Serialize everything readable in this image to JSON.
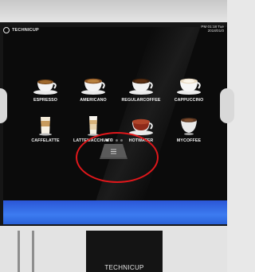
{
  "screen": {
    "brand": "TECHNICUP",
    "time": "PM 01:18 Tue",
    "date": "2018/01/0"
  },
  "drinks": [
    {
      "label": "ESPRESSO",
      "icon": "espresso-cup-icon"
    },
    {
      "label": "AMERICANO",
      "icon": "americano-cup-icon"
    },
    {
      "label": "REGULARCOFFEE",
      "icon": "regular-coffee-cup-icon"
    },
    {
      "label": "CAPPUCCINO",
      "icon": "cappuccino-cup-icon"
    },
    {
      "label": "CAFFELATTE",
      "icon": "caffelatte-glass-icon"
    },
    {
      "label": "LATTEMACCHIATO",
      "icon": "latte-macchiato-glass-icon"
    },
    {
      "label": "HOTWATER",
      "icon": "hot-water-cup-icon"
    },
    {
      "label": "MYCOFFEE",
      "icon": "mycoffee-cup-icon"
    }
  ],
  "pagination": {
    "current": 1,
    "total": 4
  },
  "machine": {
    "label": "TECHNICUP"
  },
  "colors": {
    "accent_strip": "#3c7bf0",
    "highlight": "#e0171b"
  }
}
